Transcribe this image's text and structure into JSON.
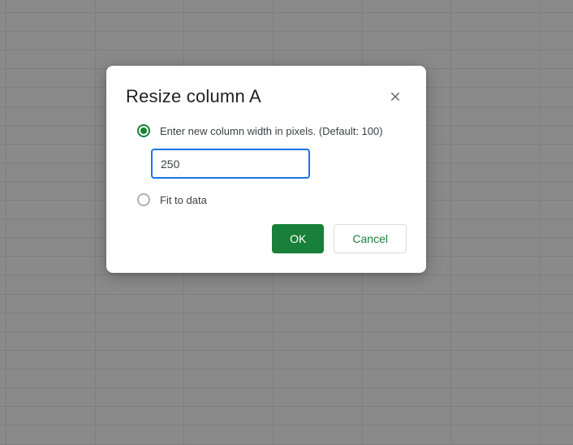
{
  "dialog": {
    "title": "Resize column A",
    "option_enter_width_label": "Enter new column width in pixels. (Default: 100)",
    "option_fit_to_data_label": "Fit to data",
    "input_value": "250",
    "ok_label": "OK",
    "cancel_label": "Cancel"
  }
}
